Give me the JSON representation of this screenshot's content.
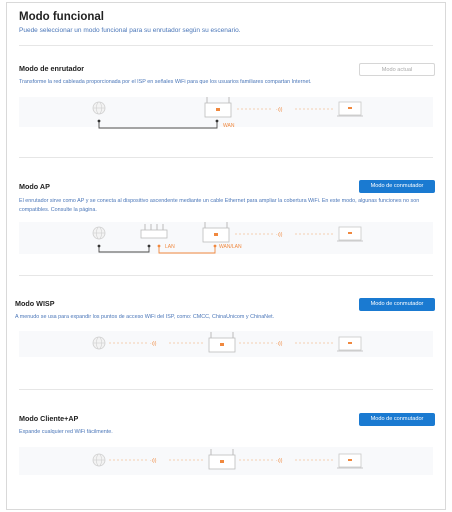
{
  "page": {
    "title": "Modo funcional",
    "subtitle": "Puede seleccionar un modo funcional para su enrutador según su escenario."
  },
  "modes": [
    {
      "title": "Modo de enrutador",
      "description": "Transforme la red cableada proporcionada por el ISP en señales WiFi para que los usuarios familiares compartan Internet.",
      "button": "Modo actual",
      "button_state": "disabled",
      "port_labels": [
        "WAN"
      ],
      "signal": "·ı))"
    },
    {
      "title": "Modo AP",
      "description": "El enrutador sirve como AP y se conecta al dispositivo ascendente mediante un cable Ethernet para ampliar la cobertura WiFi. En este modo, algunas funciones no son compatibles. Consulte la página.",
      "button": "Modo de conmutador",
      "button_state": "enabled",
      "port_labels": [
        "LAN",
        "WAN/LAN"
      ],
      "signal": "·ı))"
    },
    {
      "title": "Modo WISP",
      "description": "A menudo se usa para expandir los puntos de acceso WiFi del ISP, como: CMCC, ChinaUnicom y ChinaNet.",
      "button": "Modo de conmutador",
      "button_state": "enabled",
      "signal": "·ı))"
    },
    {
      "title": "Modo Cliente+AP",
      "description": "Expande cualquier red WiFi fácilmente.",
      "button": "Modo de conmutador",
      "button_state": "enabled",
      "signal": "·ı))"
    }
  ],
  "colors": {
    "accent": "#1a7ad1",
    "description_text": "#4a76b8",
    "signal_orange": "#f0883e",
    "device_grey": "#b8b8b8"
  },
  "icons": [
    "globe-icon",
    "router-icon",
    "switch-icon",
    "laptop-icon",
    "wifi-signal-icon"
  ]
}
